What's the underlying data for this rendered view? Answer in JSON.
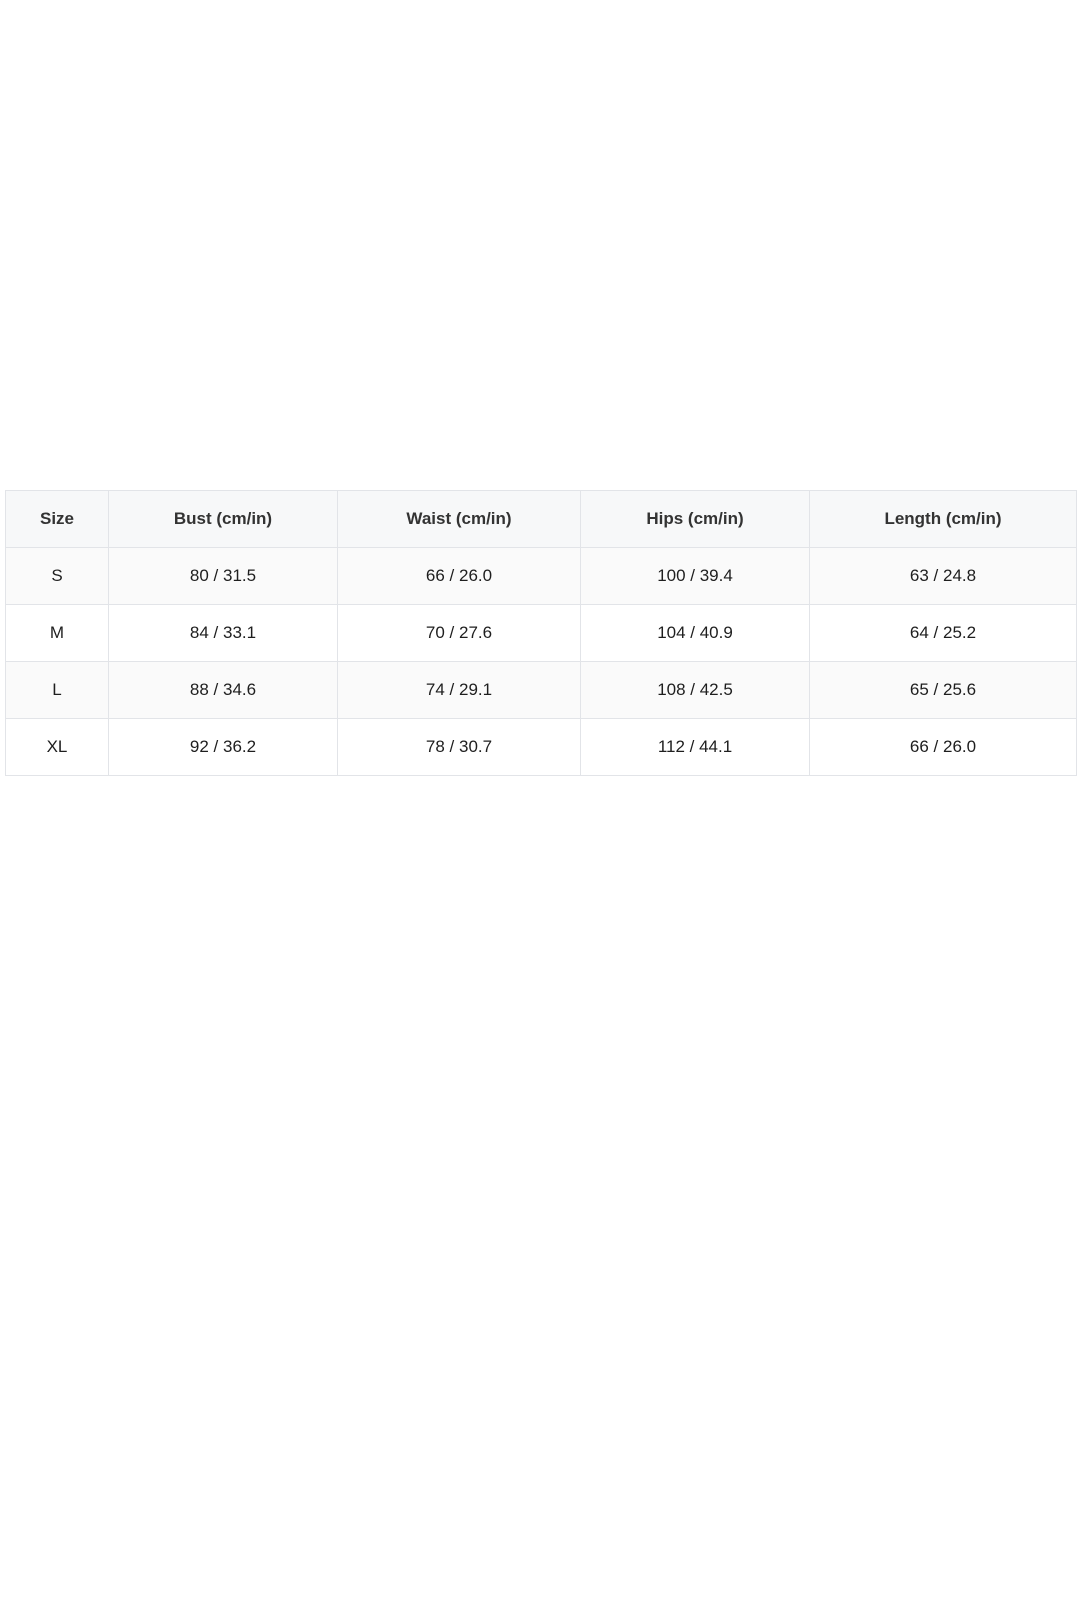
{
  "table": {
    "headers": [
      "Size",
      "Bust (cm/in)",
      "Waist (cm/in)",
      "Hips (cm/in)",
      "Length (cm/in)"
    ],
    "rows": [
      [
        "S",
        "80 / 31.5",
        "66 / 26.0",
        "100 / 39.4",
        "63 / 24.8"
      ],
      [
        "M",
        "84 / 33.1",
        "70 / 27.6",
        "104 / 40.9",
        "64 / 25.2"
      ],
      [
        "L",
        "88 / 34.6",
        "74 / 29.1",
        "108 / 42.5",
        "65 / 25.6"
      ],
      [
        "XL",
        "92 / 36.2",
        "78 / 30.7",
        "112 / 44.1",
        "66 / 26.0"
      ]
    ]
  }
}
